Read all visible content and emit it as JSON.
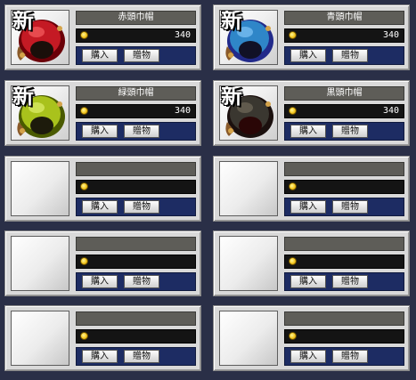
{
  "items": [
    {
      "name": "赤頭巾帽",
      "price": "340",
      "buy_label": "購入",
      "gift_label": "贈物",
      "is_new": true,
      "hood_color": "#c41a24",
      "hood_dark": "#6b0008",
      "badge": "新"
    },
    {
      "name": "青頭巾帽",
      "price": "340",
      "buy_label": "購入",
      "gift_label": "贈物",
      "is_new": true,
      "hood_color": "#2f86c8",
      "hood_dark": "#222a8a",
      "badge": "新"
    },
    {
      "name": "緑頭巾帽",
      "price": "340",
      "buy_label": "購入",
      "gift_label": "贈物",
      "is_new": true,
      "hood_color": "#a9c21c",
      "hood_dark": "#4a5a00",
      "badge": "新"
    },
    {
      "name": "黒頭巾帽",
      "price": "340",
      "buy_label": "購入",
      "gift_label": "贈物",
      "is_new": true,
      "hood_color": "#3a3730",
      "hood_dark": "#1b100e",
      "badge": "新"
    },
    {
      "name": "",
      "price": "",
      "buy_label": "購入",
      "gift_label": "贈物",
      "is_new": false
    },
    {
      "name": "",
      "price": "",
      "buy_label": "購入",
      "gift_label": "贈物",
      "is_new": false
    },
    {
      "name": "",
      "price": "",
      "buy_label": "購入",
      "gift_label": "贈物",
      "is_new": false
    },
    {
      "name": "",
      "price": "",
      "buy_label": "購入",
      "gift_label": "贈物",
      "is_new": false
    },
    {
      "name": "",
      "price": "",
      "buy_label": "購入",
      "gift_label": "贈物",
      "is_new": false
    },
    {
      "name": "",
      "price": "",
      "buy_label": "購入",
      "gift_label": "贈物",
      "is_new": false
    }
  ]
}
